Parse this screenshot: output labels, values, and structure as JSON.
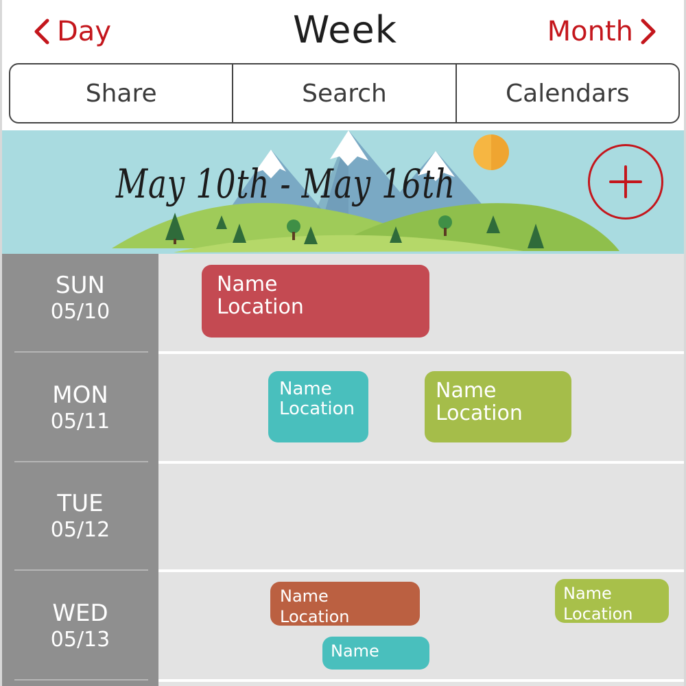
{
  "nav": {
    "prev_label": "Day",
    "title": "Week",
    "next_label": "Month"
  },
  "tabs": [
    "Share",
    "Search",
    "Calendars"
  ],
  "banner": {
    "week_range": "May 10th - May 16th",
    "add_icon": "plus-icon"
  },
  "days": [
    {
      "name": "SUN",
      "date": "05/10"
    },
    {
      "name": "MON",
      "date": "05/11"
    },
    {
      "name": "TUE",
      "date": "05/12"
    },
    {
      "name": "WED",
      "date": "05/13"
    }
  ],
  "events": {
    "sun": [
      {
        "name": "Name",
        "location": "Location",
        "color": "#c44a52"
      }
    ],
    "mon": [
      {
        "name": "Name",
        "location": "Location",
        "color": "#49bfbd"
      },
      {
        "name": "Name",
        "location": "Location",
        "color": "#a5bd4a"
      }
    ],
    "wed": [
      {
        "name": "Name",
        "location": "Location",
        "color": "#bb6041"
      },
      {
        "name": "Name",
        "location": "Location",
        "color": "#a8c04a"
      },
      {
        "name": "Name",
        "color": "#49bfbd"
      }
    ]
  },
  "colors": {
    "accent": "#c4161c",
    "day_column": "#8f8f8f",
    "grid_background": "#e3e3e3",
    "banner_sky": "#a9dbe0"
  }
}
